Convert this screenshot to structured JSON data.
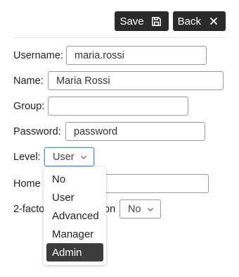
{
  "toolbar": {
    "save_label": "Save",
    "back_label": "Back"
  },
  "form": {
    "username": {
      "label": "Username:",
      "value": "maria.rossi"
    },
    "name": {
      "label": "Name:",
      "value": "Maria Rossi"
    },
    "group": {
      "label": "Group:",
      "value": ""
    },
    "password": {
      "label": "Password:",
      "value": "password"
    },
    "level": {
      "label": "Level:",
      "value": "User"
    },
    "home": {
      "label": "Home U",
      "value": ""
    },
    "twofactor": {
      "label_left": "2-facto",
      "label_right": "on",
      "value": "No"
    }
  },
  "level_dropdown": {
    "options": [
      "No",
      "User",
      "Advanced",
      "Manager",
      "Admin"
    ],
    "highlighted": "Admin"
  }
}
